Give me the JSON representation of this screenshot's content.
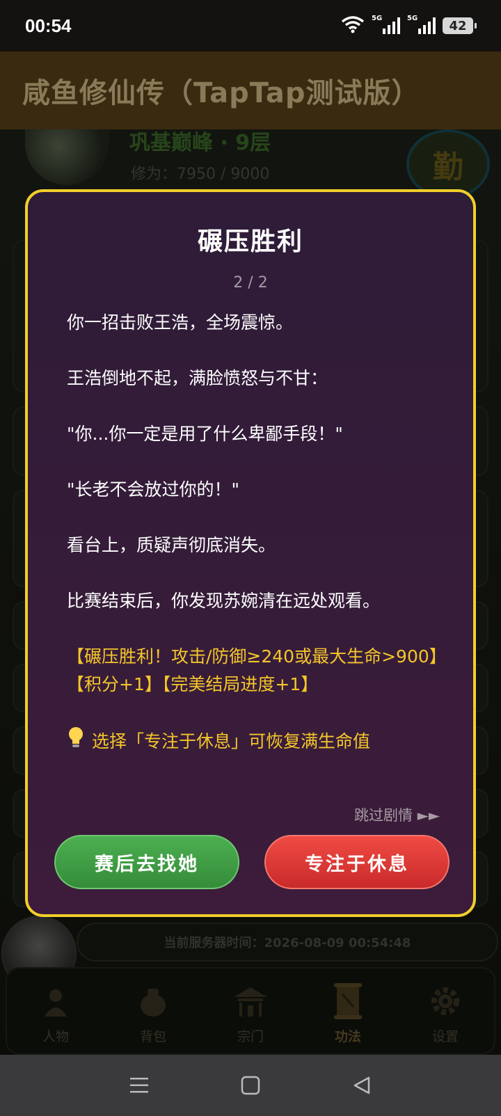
{
  "status_bar": {
    "time": "00:54",
    "signal_1_label": "5G",
    "signal_2_label": "5G",
    "battery": "42"
  },
  "app": {
    "title": "咸鱼修仙传（TapTap测试版）"
  },
  "background": {
    "realm": "巩基巅峰 · 9层",
    "cultivation": "修为：7950 / 9000",
    "effort_badge": "勤",
    "server_time": "当前服务器时间：2026-08-09 00:54:48"
  },
  "nav": {
    "items": [
      {
        "label": "人物",
        "icon": "character-icon"
      },
      {
        "label": "背包",
        "icon": "bag-icon"
      },
      {
        "label": "宗门",
        "icon": "sect-icon"
      },
      {
        "label": "功法",
        "icon": "scroll-icon"
      },
      {
        "label": "设置",
        "icon": "gear-icon"
      }
    ],
    "active": "功法"
  },
  "dialog": {
    "title": "碾压胜利",
    "page": "2 / 2",
    "lines": [
      "你一招击败王浩，全场震惊。",
      "王浩倒地不起，满脸愤怒与不甘：",
      "\"你...你一定是用了什么卑鄙手段！\"",
      "\"长老不会放过你的！\"",
      "看台上，质疑声彻底消失。",
      "比赛结束后，你发现苏婉清在远处观看。"
    ],
    "reward_1": "【碾压胜利！攻击/防御≥240或最大生命>900】",
    "reward_2": "【积分+1】【完美结局进度+1】",
    "hint": "选择「专注于休息」可恢复满生命值",
    "skip": "跳过剧情 ►►",
    "button_left": "赛后去找她",
    "button_right": "专注于休息"
  },
  "colors": {
    "dialog_border": "#f2cf2b",
    "dialog_bg": "#3a1c3a",
    "reward_text": "#f4c62a",
    "button_green": "#43a047",
    "button_red": "#e53935"
  }
}
